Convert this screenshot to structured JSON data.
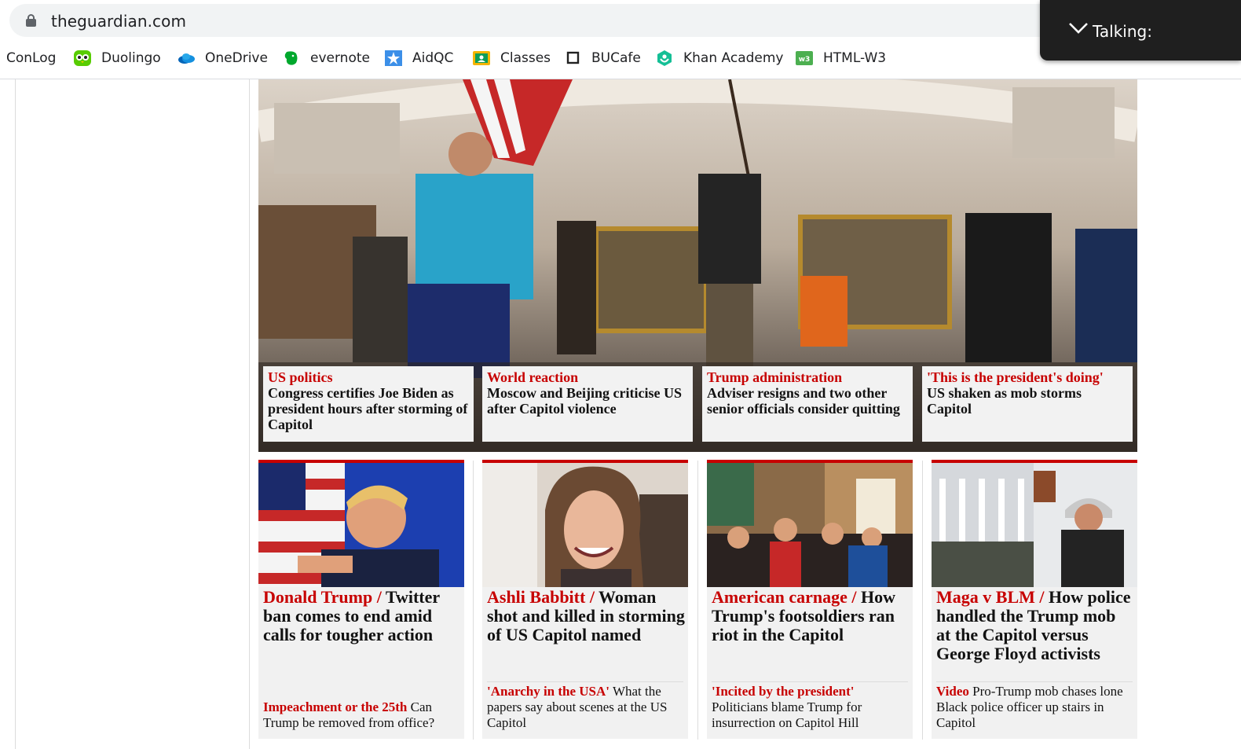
{
  "browser": {
    "url": "theguardian.com",
    "bookmarks": [
      {
        "label": "ConLog",
        "icon": "none"
      },
      {
        "label": "Duolingo",
        "icon": "duolingo-owl-icon"
      },
      {
        "label": "OneDrive",
        "icon": "onedrive-cloud-icon"
      },
      {
        "label": "evernote",
        "icon": "evernote-elephant-icon"
      },
      {
        "label": "AidQC",
        "icon": "aidqc-icon"
      },
      {
        "label": "Classes",
        "icon": "classroom-icon"
      },
      {
        "label": "BUCafe",
        "icon": "square-icon"
      },
      {
        "label": "Khan Academy",
        "icon": "khan-academy-icon"
      },
      {
        "label": "HTML-W3",
        "icon": "w3schools-icon"
      }
    ]
  },
  "talking_popup": {
    "label": "Talking:"
  },
  "hero": {
    "cards": [
      {
        "kicker": "US politics",
        "headline": "Congress certifies Joe Biden as president hours after storming of Capitol"
      },
      {
        "kicker": "World reaction",
        "headline": "Moscow and Beijing criticise US after Capitol violence"
      },
      {
        "kicker": "Trump administration",
        "headline": "Adviser resigns and two other senior officials consider quitting"
      },
      {
        "kicker": "'This is the president's doing'",
        "headline": "US shaken as mob storms Capitol"
      }
    ]
  },
  "stories": [
    {
      "kicker": "Donald Trump",
      "headline": "Twitter ban comes to end amid calls for tougher action",
      "sub_kicker": "Impeachment or the 25th",
      "sub_text": "Can Trump be removed from office?"
    },
    {
      "kicker": "Ashli Babbitt",
      "headline": "Woman shot and killed in storming of US Capitol named",
      "sub_kicker": "'Anarchy in the USA'",
      "sub_text": "What the papers say about scenes at the US Capitol"
    },
    {
      "kicker": "American carnage",
      "headline": "How Trump's footsoldiers ran riot in the Capitol",
      "sub_kicker": "'Incited by the president'",
      "sub_text": "Politicians blame Trump for insurrection on Capitol Hill"
    },
    {
      "kicker": "Maga v BLM",
      "headline": "How police handled the Trump mob at the Capitol versus George Floyd activists",
      "sub_kicker": "Video",
      "sub_text": "Pro-Trump mob chases lone Black police officer up stairs in Capitol"
    }
  ],
  "colors": {
    "accent": "#c70000",
    "text": "#121212",
    "card_bg": "#f1f1f1"
  }
}
